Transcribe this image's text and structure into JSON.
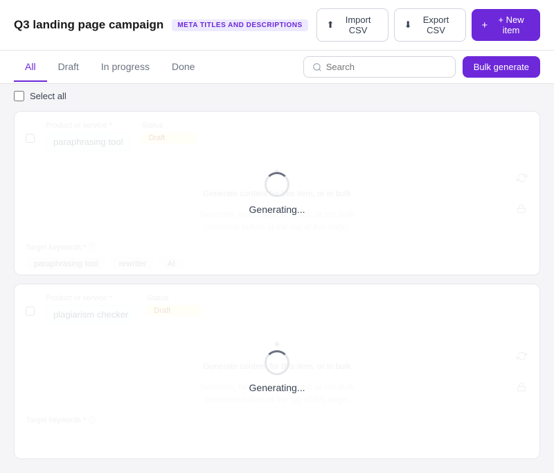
{
  "header": {
    "title": "Q3 landing page campaign",
    "badge": "META TITLES AND DESCRIPTIONS",
    "import_label": "Import CSV",
    "export_label": "Export CSV",
    "new_item_label": "+ New item"
  },
  "tabs": {
    "items": [
      "All",
      "Draft",
      "In progress",
      "Done"
    ],
    "active": "All"
  },
  "search": {
    "placeholder": "Search"
  },
  "bulk_generate": {
    "label": "Bulk generate"
  },
  "select_all": {
    "label": "Select all"
  },
  "cards": [
    {
      "id": "card-1",
      "product_label": "Product or service *",
      "product_value": "paraphrasing tool",
      "status_label": "Status",
      "status_value": "Draft",
      "generating": true,
      "generate_hint": "Generate content for this item, or in bulk",
      "generate_desc": "Generate, face-adjust the cost, or the Bulk\nGenerate button at the top of this page.",
      "target_label": "Target keywords * ⓘ",
      "target_value": "...",
      "tags": [
        "paraphrasing tool",
        "rewriter"
      ],
      "ai_tag": "AI",
      "cursor_visible": true
    },
    {
      "id": "card-2",
      "product_label": "Product or service *",
      "product_value": "plagiarism checker",
      "status_label": "Status",
      "status_value": "Draft",
      "generating": true,
      "generate_hint": "Generate content for this item, or in bulk",
      "generate_desc": "Generate, face-adjust the cost, or the Bulk\nGenerate button at the top of this page.",
      "target_label": "Target keywords * ⓘ",
      "target_value": "...",
      "tags": [],
      "ai_tag": "",
      "cursor_visible": false
    }
  ],
  "icons": {
    "upload": "↑",
    "download": "↓",
    "plus": "+",
    "search": "🔍",
    "refresh": "↻",
    "lock": "🔒",
    "sparkle": "✦",
    "generating": "Generating..."
  }
}
